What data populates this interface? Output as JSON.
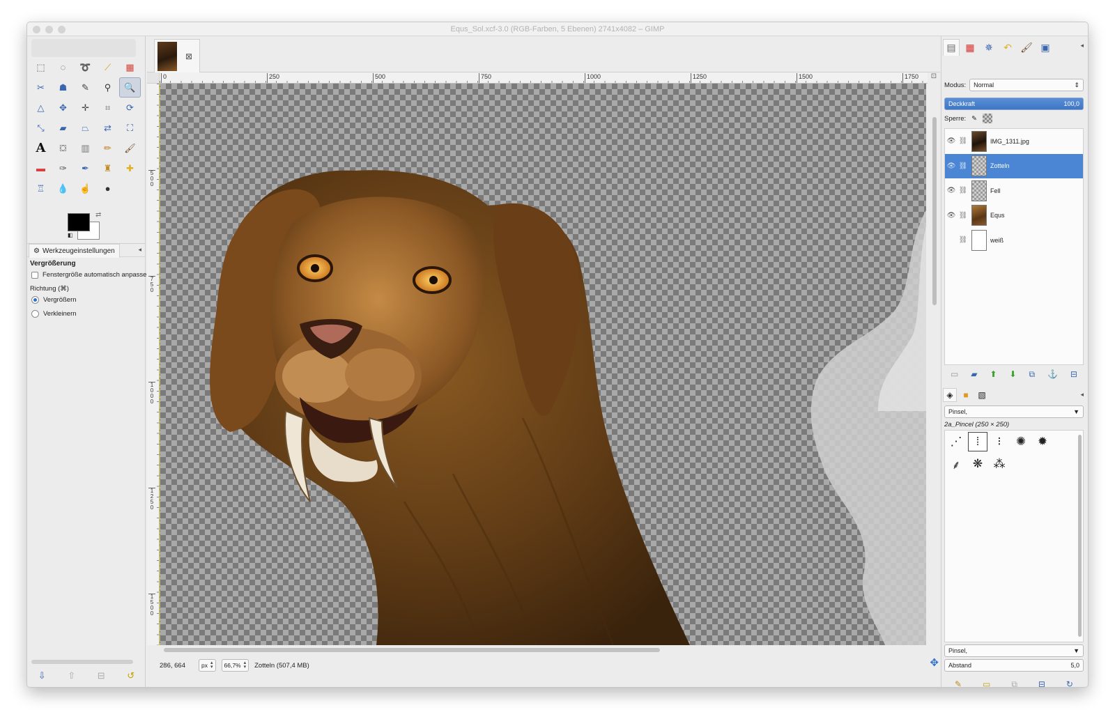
{
  "window": {
    "title": "Equs_Sol.xcf-3.0 (RGB-Farben, 5 Ebenen) 2741x4082 – GIMP"
  },
  "toolbox": {
    "tools": [
      {
        "name": "rect-select-icon",
        "glyph": "⬚",
        "color": "#555555"
      },
      {
        "name": "ellipse-select-icon",
        "glyph": "◌",
        "color": "#555555"
      },
      {
        "name": "lasso-icon",
        "glyph": "➰",
        "color": "#555555"
      },
      {
        "name": "fuzzy-select-icon",
        "glyph": "⟋",
        "color": "#c9a000"
      },
      {
        "name": "color-select-icon",
        "glyph": "▦",
        "color": "#d8443c"
      },
      {
        "name": "scissors-icon",
        "glyph": "✂",
        "color": "#3a66b0"
      },
      {
        "name": "foreground-select-icon",
        "glyph": "☗",
        "color": "#3a66b0"
      },
      {
        "name": "paths-icon",
        "glyph": "✎",
        "color": "#444444"
      },
      {
        "name": "color-picker-icon",
        "glyph": "⚲",
        "color": "#333333"
      },
      {
        "name": "zoom-icon",
        "glyph": "🔍",
        "color": "#2a5fb5"
      },
      {
        "name": "measure-icon",
        "glyph": "△",
        "color": "#3a66b0"
      },
      {
        "name": "move-icon",
        "glyph": "✥",
        "color": "#3a66b0"
      },
      {
        "name": "align-icon",
        "glyph": "✛",
        "color": "#444444"
      },
      {
        "name": "crop-icon",
        "glyph": "⌗",
        "color": "#666666"
      },
      {
        "name": "rotate-icon",
        "glyph": "⟳",
        "color": "#3a66b0"
      },
      {
        "name": "scale-icon",
        "glyph": "⤡",
        "color": "#3a66b0"
      },
      {
        "name": "shear-icon",
        "glyph": "▰",
        "color": "#3a66b0"
      },
      {
        "name": "perspective-icon",
        "glyph": "⏢",
        "color": "#3a66b0"
      },
      {
        "name": "flip-icon",
        "glyph": "⇄",
        "color": "#3a66b0"
      },
      {
        "name": "cage-icon",
        "glyph": "⛶",
        "color": "#3a66b0"
      },
      {
        "name": "text-icon",
        "glyph": "A",
        "color": "#111111"
      },
      {
        "name": "bucket-fill-icon",
        "glyph": "⛋",
        "color": "#555555"
      },
      {
        "name": "gradient-icon",
        "glyph": "▥",
        "color": "#777777"
      },
      {
        "name": "pencil-icon",
        "glyph": "✏",
        "color": "#c07a20"
      },
      {
        "name": "paintbrush-icon",
        "glyph": "🖌",
        "color": "#6a4a2a"
      },
      {
        "name": "eraser-icon",
        "glyph": "▬",
        "color": "#d84040"
      },
      {
        "name": "airbrush-icon",
        "glyph": "✑",
        "color": "#555555"
      },
      {
        "name": "ink-icon",
        "glyph": "✒",
        "color": "#3a66b0"
      },
      {
        "name": "clone-icon",
        "glyph": "♜",
        "color": "#c08a20"
      },
      {
        "name": "heal-icon",
        "glyph": "✚",
        "color": "#e0b020"
      },
      {
        "name": "perspective-clone-icon",
        "glyph": "♖",
        "color": "#3a66b0"
      },
      {
        "name": "blur-icon",
        "glyph": "💧",
        "color": "#3a86d0"
      },
      {
        "name": "smudge-icon",
        "glyph": "☝",
        "color": "#c08040"
      },
      {
        "name": "dodge-burn-icon",
        "glyph": "●",
        "color": "#333333"
      }
    ],
    "options_tab": "Werkzeugeinstellungen",
    "options_title": "Vergrößerung",
    "auto_resize_label": "Fenstergröße automatisch anpassen",
    "auto_resize_checked": false,
    "direction_label": "Richtung (⌘)",
    "zoom_in_label": "Vergrößern",
    "zoom_out_label": "Verkleinern",
    "direction_selected": "Vergrößern"
  },
  "canvas": {
    "ruler_h": [
      "0",
      "250",
      "500",
      "750",
      "1000",
      "1250",
      "1500",
      "1750"
    ],
    "ruler_v": [
      "500",
      "750",
      "1000",
      "1250",
      "1500"
    ],
    "status_coords": "286, 664",
    "unit": "px",
    "zoom": "66,7%",
    "status_info": "Zotteln (507,4 MB)"
  },
  "layers": {
    "mode_label": "Modus:",
    "mode_value": "Normal",
    "opacity_label": "Deckkraft",
    "opacity_value": "100,0",
    "lock_label": "Sperre:",
    "items": [
      {
        "name": "IMG_1311.jpg",
        "visible": true,
        "selected": false
      },
      {
        "name": "Zotteln",
        "visible": true,
        "selected": true
      },
      {
        "name": "Fell",
        "visible": true,
        "selected": false
      },
      {
        "name": "Equs",
        "visible": true,
        "selected": false
      },
      {
        "name": "weiß",
        "visible": false,
        "selected": false
      }
    ]
  },
  "brushes": {
    "filter": "Pinsel,",
    "selected_name": "2a_Pincel (250 × 250)",
    "tag_filter": "Pinsel,",
    "spacing_label": "Abstand",
    "spacing_value": "5,0"
  },
  "colors": {
    "foreground": "#000000",
    "background": "#ffffff",
    "selection": "#4a86d4"
  }
}
